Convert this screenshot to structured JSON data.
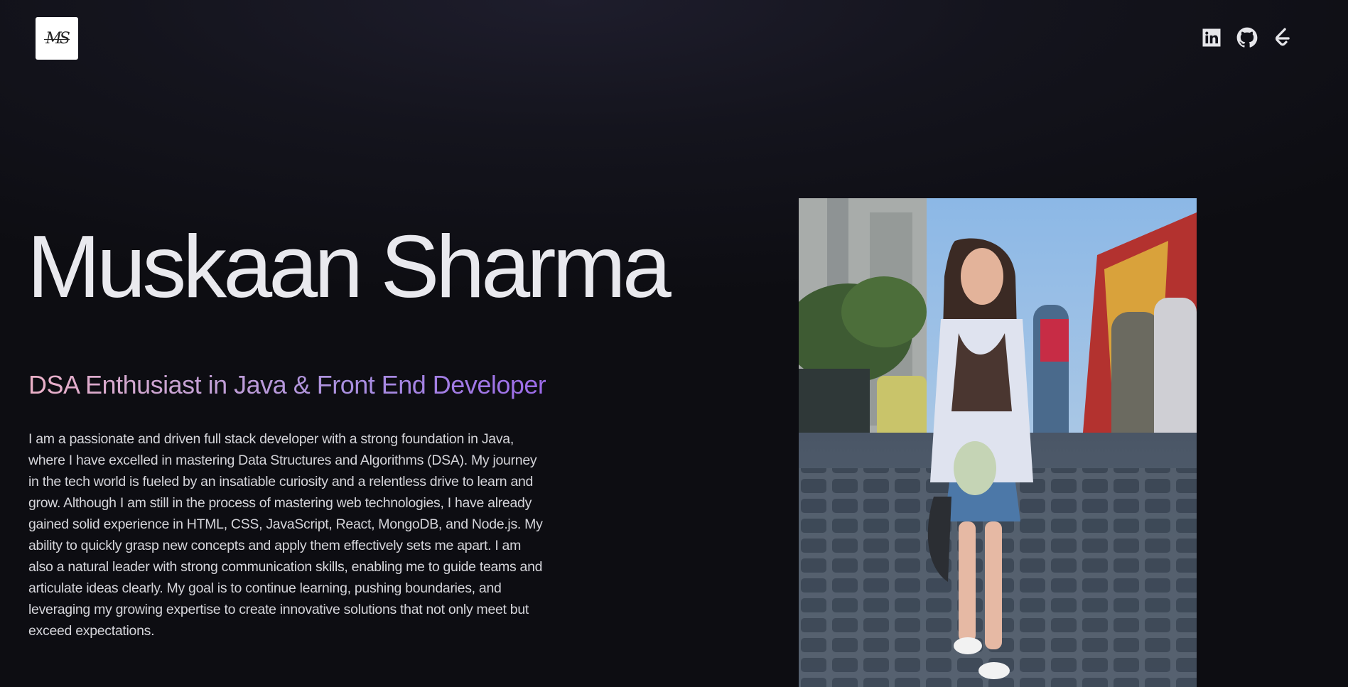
{
  "header": {
    "logo_text": "MS",
    "social_links": [
      {
        "icon": "linkedin-icon"
      },
      {
        "icon": "github-icon"
      },
      {
        "icon": "leetcode-icon"
      }
    ]
  },
  "hero": {
    "name": "Muskaan Sharma",
    "tagline": "DSA Enthusiast in Java & Front End Developer",
    "bio": "I am a passionate and driven full stack developer with a strong foundation in Java, where I have excelled in mastering Data Structures and Algorithms (DSA). My journey in the tech world is fueled by an insatiable curiosity and a relentless drive to learn and grow. Although I am still in the process of mastering web technologies, I have already gained solid experience in HTML, CSS, JavaScript, React, MongoDB, and Node.js. My ability to quickly grasp new concepts and apply them effectively sets me apart. I am also a natural leader with strong communication skills, enabling me to guide teams and articulate ideas clearly. My goal is to continue learning, pushing boundaries, and leveraging my growing expertise to create innovative solutions that not only meet but exceed expectations."
  },
  "theme": {
    "tagline_gradient": [
      "#ecb1c8",
      "#c9a3d2",
      "#aa90e0",
      "#9b6ae8"
    ],
    "background": "#0d0d12"
  }
}
